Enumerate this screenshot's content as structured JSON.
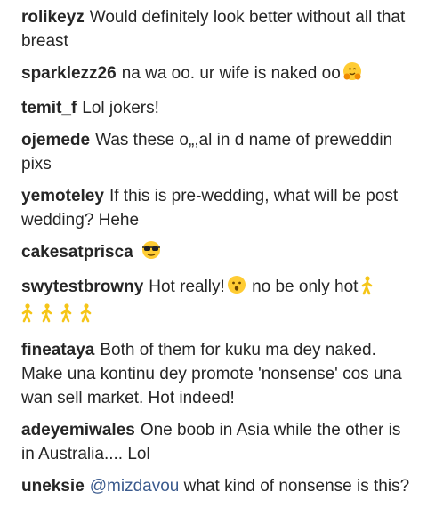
{
  "comments": [
    {
      "username": "rolikeyz",
      "text": "Would definitely look better without all that breast"
    },
    {
      "username": "sparklezz26",
      "text": "na wa oo. ur wife is naked oo",
      "emoji": "hugging-face-emoji"
    },
    {
      "username": "temit_f",
      "text": "Lol jokers!"
    },
    {
      "username": "ojemede",
      "text": "Was these o„,al in d name of preweddin pixs"
    },
    {
      "username": "yemoteley",
      "text": "If this is pre-wedding, what will be post wedding? Hehe"
    },
    {
      "username": "cakesatprisca",
      "text": "",
      "emoji": "sunglasses-face-emoji"
    },
    {
      "username": "swytestbrowny",
      "text": "Hot really!",
      "text_after": "no be only hot",
      "emoji": "hushed-face-emoji",
      "trailing_emoji": "person-walking-emoji",
      "trailing_count": 5
    },
    {
      "username": "fineataya",
      "text": "Both of them for kuku ma dey naked. Make una kontinu dey promote 'nonsense' cos una wan sell market. Hot indeed!"
    },
    {
      "username": "adeyemiwales",
      "text": "One boob in Asia while the other is in Australia.... Lol"
    },
    {
      "username": "uneksie",
      "mention": "@mizdavou",
      "text": "what kind of nonsense is this?"
    }
  ],
  "colors": {
    "text": "#262626",
    "mention": "#3b5b8e",
    "emoji_yellow": "#ffcc33",
    "walker_yellow": "#f5c518"
  }
}
